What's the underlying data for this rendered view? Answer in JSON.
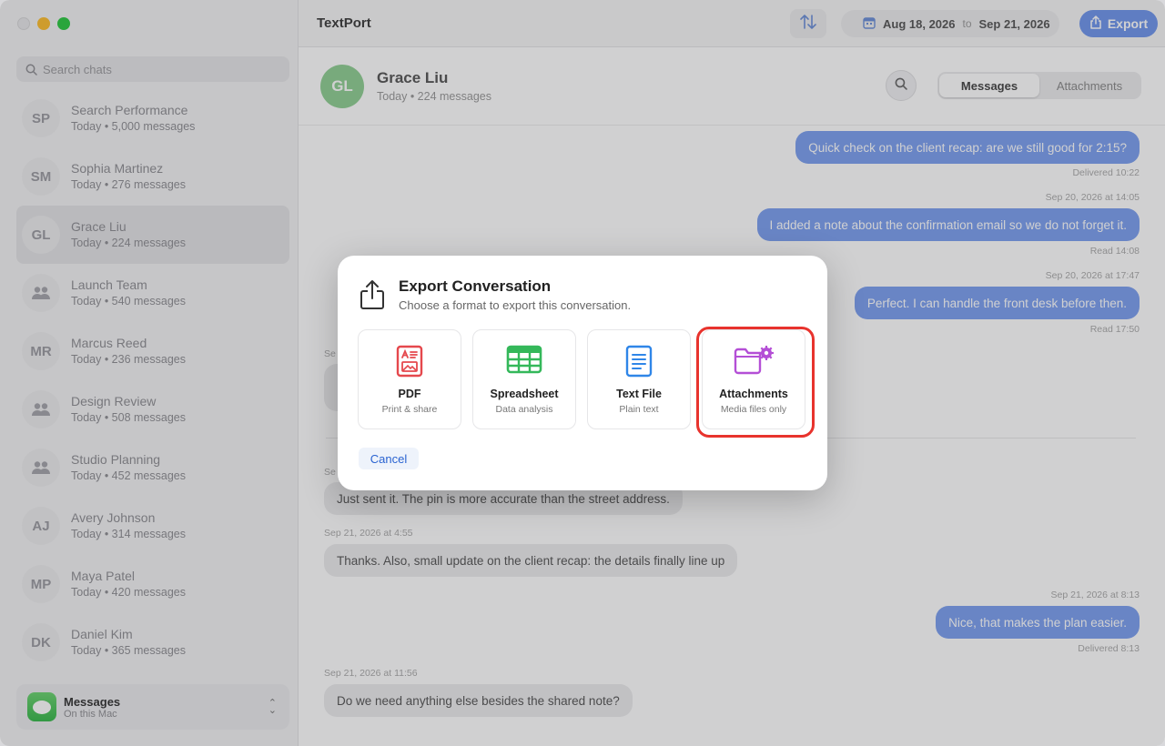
{
  "app": {
    "title": "TextPort"
  },
  "search": {
    "placeholder": "Search chats"
  },
  "sidebar": {
    "chats": [
      {
        "initials": "SP",
        "name": "Search Performance",
        "sub": "Today • 5,000 messages",
        "group": false
      },
      {
        "initials": "SM",
        "name": "Sophia Martinez",
        "sub": "Today • 276 messages",
        "group": false
      },
      {
        "initials": "GL",
        "name": "Grace Liu",
        "sub": "Today • 224 messages",
        "group": false,
        "active": true
      },
      {
        "initials": "",
        "name": "Launch Team",
        "sub": "Today • 540 messages",
        "group": true
      },
      {
        "initials": "MR",
        "name": "Marcus Reed",
        "sub": "Today • 236 messages",
        "group": false
      },
      {
        "initials": "",
        "name": "Design Review",
        "sub": "Today • 508 messages",
        "group": true
      },
      {
        "initials": "",
        "name": "Studio Planning",
        "sub": "Today • 452 messages",
        "group": true
      },
      {
        "initials": "AJ",
        "name": "Avery Johnson",
        "sub": "Today • 314 messages",
        "group": false
      },
      {
        "initials": "MP",
        "name": "Maya Patel",
        "sub": "Today • 420 messages",
        "group": false
      },
      {
        "initials": "DK",
        "name": "Daniel Kim",
        "sub": "Today • 365 messages",
        "group": false
      }
    ],
    "footer": {
      "title": "Messages",
      "sub": "On this Mac"
    }
  },
  "toolbar": {
    "date_from": "Aug 18, 2026",
    "date_to_label": "to",
    "date_to": "Sep 21, 2026",
    "export_label": "Export"
  },
  "conversation": {
    "initials": "GL",
    "name": "Grace Liu",
    "sub": "Today • 224 messages",
    "tabs": {
      "messages": "Messages",
      "attachments": "Attachments"
    },
    "messages": [
      {
        "text": "Quick check on the client recap: are we still good for 2:15?",
        "status": "Delivered 10:22"
      },
      {
        "timestamp": "Sep 20, 2026 at 14:05",
        "text": "I added a note about the confirmation email so we do not forget it.",
        "status": "Read 14:08"
      },
      {
        "timestamp": "Sep 20, 2026 at 17:47",
        "text": "Perfect. I can handle the front desk before then.",
        "status": "Read 17:50"
      },
      {
        "timestamp": "Se",
        "text": ""
      },
      {
        "timestamp": "Se",
        "text": "Just sent it. The pin is more accurate than the street address."
      },
      {
        "timestamp": "Sep 21, 2026 at 4:55",
        "text": "Thanks. Also, small update on the client recap: the details finally line up"
      },
      {
        "timestamp": "Sep 21, 2026 at 8:13",
        "text": "Nice, that makes the plan easier.",
        "status": "Delivered 8:13"
      },
      {
        "timestamp": "Sep 21, 2026 at 11:56",
        "text": "Do we need anything else besides the shared note?"
      }
    ]
  },
  "dialog": {
    "title": "Export Conversation",
    "subtitle": "Choose a format to export this conversation.",
    "options": [
      {
        "title": "PDF",
        "sub": "Print & share",
        "icon": "pdf-icon",
        "color": "#e5484d"
      },
      {
        "title": "Spreadsheet",
        "sub": "Data analysis",
        "icon": "spreadsheet-icon",
        "color": "#34b85a"
      },
      {
        "title": "Text File",
        "sub": "Plain text",
        "icon": "text-file-icon",
        "color": "#2f86e8"
      },
      {
        "title": "Attachments",
        "sub": "Media files only",
        "icon": "folder-gear-icon",
        "color": "#b44fd6"
      }
    ],
    "cancel_label": "Cancel"
  },
  "colors": {
    "accent": "#6f95ec",
    "highlight": "#e8332d"
  }
}
